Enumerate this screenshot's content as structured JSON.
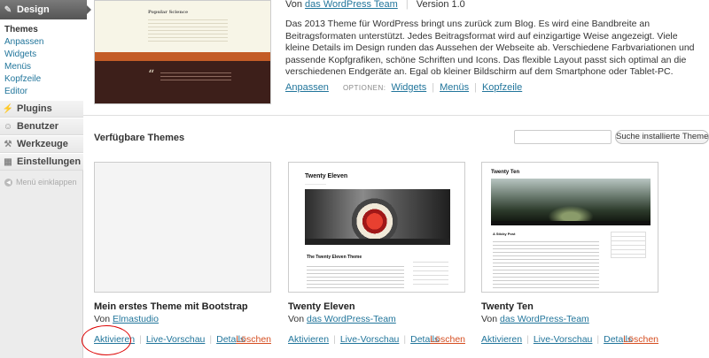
{
  "sidebar": {
    "design_label": "Design",
    "submenu": [
      "Themes",
      "Anpassen",
      "Widgets",
      "Menüs",
      "Kopfzeile",
      "Editor"
    ],
    "items": [
      {
        "label": "Plugins",
        "icon": "plug-icon"
      },
      {
        "label": "Benutzer",
        "icon": "users-icon"
      },
      {
        "label": "Werkzeuge",
        "icon": "tools-icon"
      },
      {
        "label": "Einstellungen",
        "icon": "settings-icon"
      }
    ],
    "collapse_label": "Menü einklappen"
  },
  "current_theme": {
    "by_prefix": "Von",
    "author": "das WordPress Team",
    "version": "Version 1.0",
    "description": "Das 2013 Theme für WordPress bringt uns zurück zum Blog. Es wird eine Bandbreite an Beitragsformaten unterstützt. Jedes Beitragsformat wird auf einzigartige Weise angezeigt. Viele kleine Details im Design runden das Aussehen der Webseite ab. Verschiedene Farbvariationen und passende Kopfgrafiken, schöne Schriften und Icons. Das flexible Layout passt sich optimal an die verschiedenen Endgeräte an. Egal ob kleiner Bildschirm auf dem Smartphone oder Tablet-PC.",
    "customize_label": "Anpassen",
    "options_label": "OPTIONEN:",
    "options": [
      "Widgets",
      "Menüs",
      "Kopfzeile"
    ],
    "screenshot": {
      "title": "Popular Science"
    }
  },
  "available": {
    "title": "Verfügbare Themes",
    "search_placeholder": "",
    "search_button": "Suche installierte Themes"
  },
  "themes": [
    {
      "name": "Mein erstes Theme mit Bootstrap",
      "by_prefix": "Von",
      "author": "Elmastudio",
      "actions": [
        "Aktivieren",
        "Live-Vorschau",
        "Details"
      ],
      "delete": "Löschen"
    },
    {
      "name": "Twenty Eleven",
      "by_prefix": "Von",
      "author": "das WordPress-Team",
      "actions": [
        "Aktivieren",
        "Live-Vorschau",
        "Details"
      ],
      "delete": "Löschen",
      "screenshot": {
        "title": "Twenty Eleven",
        "post_title": "The Twenty Eleven Theme"
      }
    },
    {
      "name": "Twenty Ten",
      "by_prefix": "Von",
      "author": "das WordPress-Team",
      "actions": [
        "Aktivieren",
        "Live-Vorschau",
        "Details"
      ],
      "delete": "Löschen",
      "screenshot": {
        "title": "Twenty Ten",
        "post_title": "A Sticky Post"
      }
    }
  ],
  "colors": {
    "link": "#21759b",
    "delete": "#d54e21",
    "highlight": "#dd0000"
  }
}
